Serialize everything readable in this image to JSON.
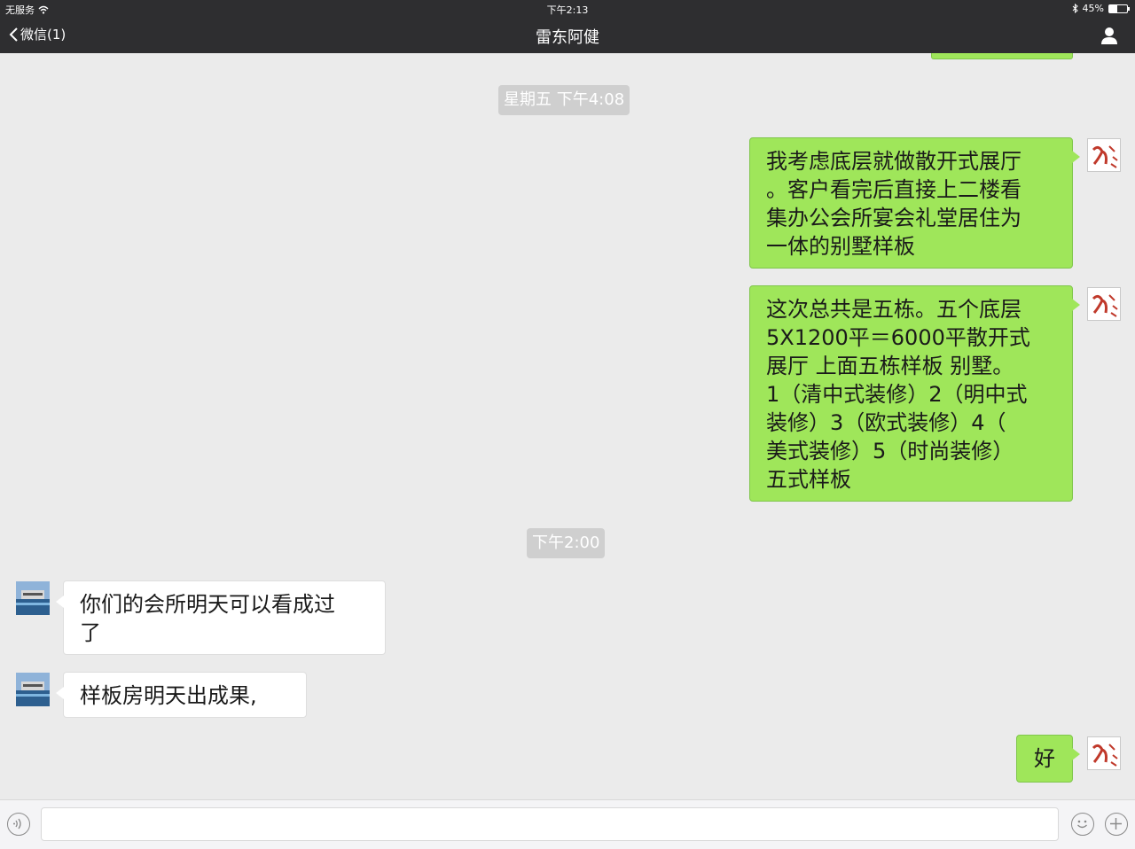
{
  "status_bar": {
    "carrier": "无服务",
    "time": "下午2:13",
    "battery": "45%",
    "battery_level": 0.45
  },
  "nav": {
    "back_label": "微信(1)",
    "title": "雷东阿健"
  },
  "chat": {
    "timestamps": [
      "星期五 下午4:08",
      "下午2:00"
    ],
    "messages": [
      {
        "sender": "me",
        "lines": [
          "我考虑底层就做散开式展厅",
          "。客户看完后直接上二楼看",
          "集办公会所宴会礼堂居住为",
          "一体的别墅样板"
        ]
      },
      {
        "sender": "me",
        "lines": [
          "这次总共是五栋。五个底层",
          "5X1200平＝6000平散开式",
          "展厅 上面五栋样板 别墅。",
          "1（清中式装修）2（明中式",
          "装修）3（欧式装修）4（",
          "美式装修）5（时尚装修）",
          "五式样板"
        ]
      },
      {
        "sender": "other",
        "lines": [
          "你们的会所明天可以看成过",
          "了"
        ]
      },
      {
        "sender": "other",
        "lines": [
          "样板房明天出成果,"
        ]
      },
      {
        "sender": "me",
        "lines": [
          "好"
        ]
      }
    ]
  },
  "colors": {
    "bar": "#2e2e30",
    "outgoing": "#9fe65a",
    "incoming": "#ffffff",
    "background": "#ebebeb",
    "timestamp_bg": "#cfcfcf"
  }
}
